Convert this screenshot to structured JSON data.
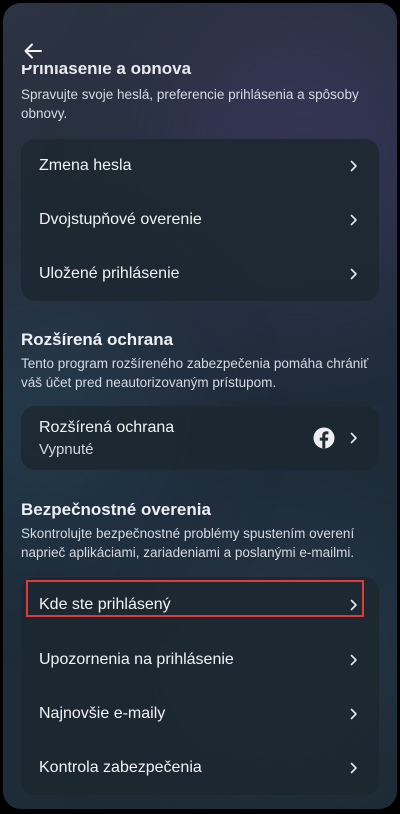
{
  "header": {
    "back_icon": "arrow-left-icon",
    "partial_heading": "Prihlásenie a obnova"
  },
  "login_section": {
    "description": "Spravujte svoje heslá, preferencie prihlásenia a spôsoby obnovy.",
    "items": [
      {
        "label": "Zmena hesla"
      },
      {
        "label": "Dvojstupňové overenie"
      },
      {
        "label": "Uložené prihlásenie"
      }
    ]
  },
  "advanced_section": {
    "title": "Rozšírená ochrana",
    "description": "Tento program rozšíreného zabezpečenia pomáha chrániť váš účet pred neautorizovaným prístupom.",
    "item": {
      "label": "Rozšírená ochrana",
      "status": "Vypnuté",
      "icon": "facebook-icon"
    }
  },
  "security_section": {
    "title": "Bezpečnostné overenia",
    "description": "Skontrolujte bezpečnostné problémy spustením overení naprieč aplikáciami, zariadeniami a poslanými e-mailmi.",
    "items": [
      {
        "label": "Kde ste prihlásený",
        "highlighted": true
      },
      {
        "label": "Upozornenia na prihlásenie"
      },
      {
        "label": "Najnovšie e-maily"
      },
      {
        "label": "Kontrola zabezpečenia"
      }
    ]
  },
  "colors": {
    "highlight_border": "#e23a3a",
    "card_background": "#1c2830",
    "text_primary": "#f2f3f5"
  }
}
